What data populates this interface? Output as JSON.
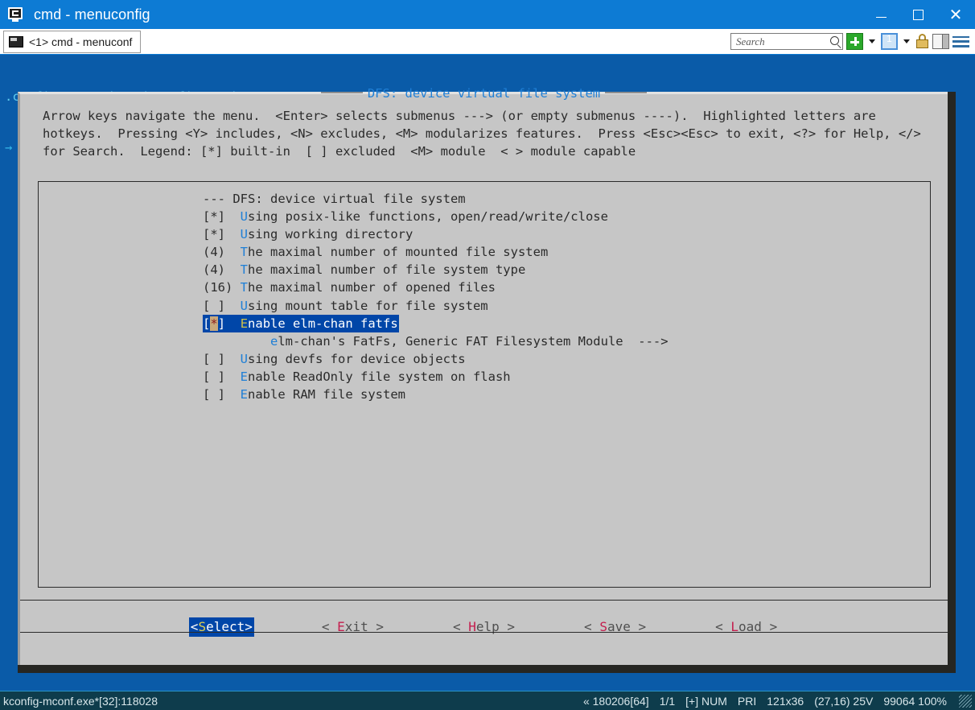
{
  "window": {
    "title": "cmd - menuconfig",
    "icon": "terminal-icon",
    "minimize_label": "Minimize",
    "maximize_label": "Maximize",
    "close_label": "Close"
  },
  "tabbar": {
    "tabs": [
      {
        "label": "<1> cmd - menuconf",
        "icon": "console-icon"
      }
    ],
    "search": {
      "placeholder": "Search",
      "value": "",
      "icon": "magnifier-icon"
    },
    "tools": [
      {
        "name": "new-tab-button",
        "icon": "green-plus-icon",
        "label": "+"
      },
      {
        "name": "new-tab-dropdown",
        "icon": "chevron-down-icon",
        "label": ""
      },
      {
        "name": "window-button",
        "icon": "window-1-icon",
        "label": "1"
      },
      {
        "name": "window-dropdown",
        "icon": "chevron-down-icon",
        "label": ""
      },
      {
        "name": "lock-button",
        "icon": "padlock-icon",
        "label": ""
      },
      {
        "name": "split-view-button",
        "icon": "split-pane-icon",
        "label": ""
      },
      {
        "name": "menu-button",
        "icon": "hamburger-menu-icon",
        "label": ""
      }
    ]
  },
  "terminal": {
    "header_line1": ".config - RT-Thread Configuration",
    "header_line2": "→ RT-Thread Components → DFS: device virtual file system"
  },
  "dialog": {
    "title": "DFS: device virtual file system",
    "help_text": "Arrow keys navigate the menu.  <Enter> selects submenus ---> (or empty submenus ----).  Highlighted letters are hotkeys.  Pressing <Y> includes, <N> excludes, <M> modularizes features.  Press <Esc><Esc> to exit, <?> for Help, </> for Search.  Legend: [*] built-in  [ ] excluded  <M> module  < > module capable",
    "menu": {
      "header": "--- DFS: device virtual file system",
      "items": [
        {
          "marker": "[*]",
          "hotkey": "U",
          "label": "sing posix-like functions, open/read/write/close",
          "selected": false,
          "submenu": ""
        },
        {
          "marker": "[*]",
          "hotkey": "U",
          "label": "sing working directory",
          "selected": false,
          "submenu": ""
        },
        {
          "marker": "(4)",
          "hotkey": "T",
          "label": "he maximal number of mounted file system",
          "selected": false,
          "submenu": ""
        },
        {
          "marker": "(4)",
          "hotkey": "T",
          "label": "he maximal number of file system type",
          "selected": false,
          "submenu": ""
        },
        {
          "marker": "(16)",
          "hotkey": "T",
          "label": "he maximal number of opened files",
          "selected": false,
          "submenu": ""
        },
        {
          "marker": "[ ]",
          "hotkey": "U",
          "label": "sing mount table for file system",
          "selected": false,
          "submenu": ""
        },
        {
          "marker": "[*]",
          "hotkey": "E",
          "label": "nable elm-chan fatfs",
          "selected": true,
          "submenu": ""
        },
        {
          "marker": "",
          "hotkey": "e",
          "label": "lm-chan's FatFs, Generic FAT Filesystem Module",
          "selected": false,
          "submenu": "--->"
        },
        {
          "marker": "[ ]",
          "hotkey": "U",
          "label": "sing devfs for device objects",
          "selected": false,
          "submenu": ""
        },
        {
          "marker": "[ ]",
          "hotkey": "E",
          "label": "nable ReadOnly file system on flash",
          "selected": false,
          "submenu": ""
        },
        {
          "marker": "[ ]",
          "hotkey": "E",
          "label": "nable RAM file system",
          "selected": false,
          "submenu": ""
        }
      ]
    },
    "buttons": [
      {
        "open": "<",
        "hotkey": "S",
        "rest": "elect",
        "close": ">",
        "active": true
      },
      {
        "open": "< ",
        "hotkey": "E",
        "rest": "xit",
        "close": " >",
        "active": false
      },
      {
        "open": "< ",
        "hotkey": "H",
        "rest": "elp",
        "close": " >",
        "active": false
      },
      {
        "open": "< ",
        "hotkey": "S",
        "rest": "ave",
        "close": " >",
        "active": false
      },
      {
        "open": "< ",
        "hotkey": "L",
        "rest": "oad",
        "close": " >",
        "active": false
      }
    ]
  },
  "statusbar": {
    "left": "kconfig-mconf.exe*[32]:118028",
    "items": [
      "« 180206[64]",
      "1/1",
      "[+] NUM",
      "PRI",
      "121x36",
      "(27,16) 25V",
      "99064 100%"
    ]
  },
  "colors": {
    "title_bar": "#0d7bd4",
    "terminal_bg": "#0a5ba8",
    "dialog_bg": "#c6c6c6",
    "selection_bg": "#0046a8",
    "hotkey_blue": "#1f7fd6",
    "hotkey_red": "#c41e4e",
    "cursor_bg": "#c8a87c",
    "status_bg": "#0e3c4c"
  }
}
